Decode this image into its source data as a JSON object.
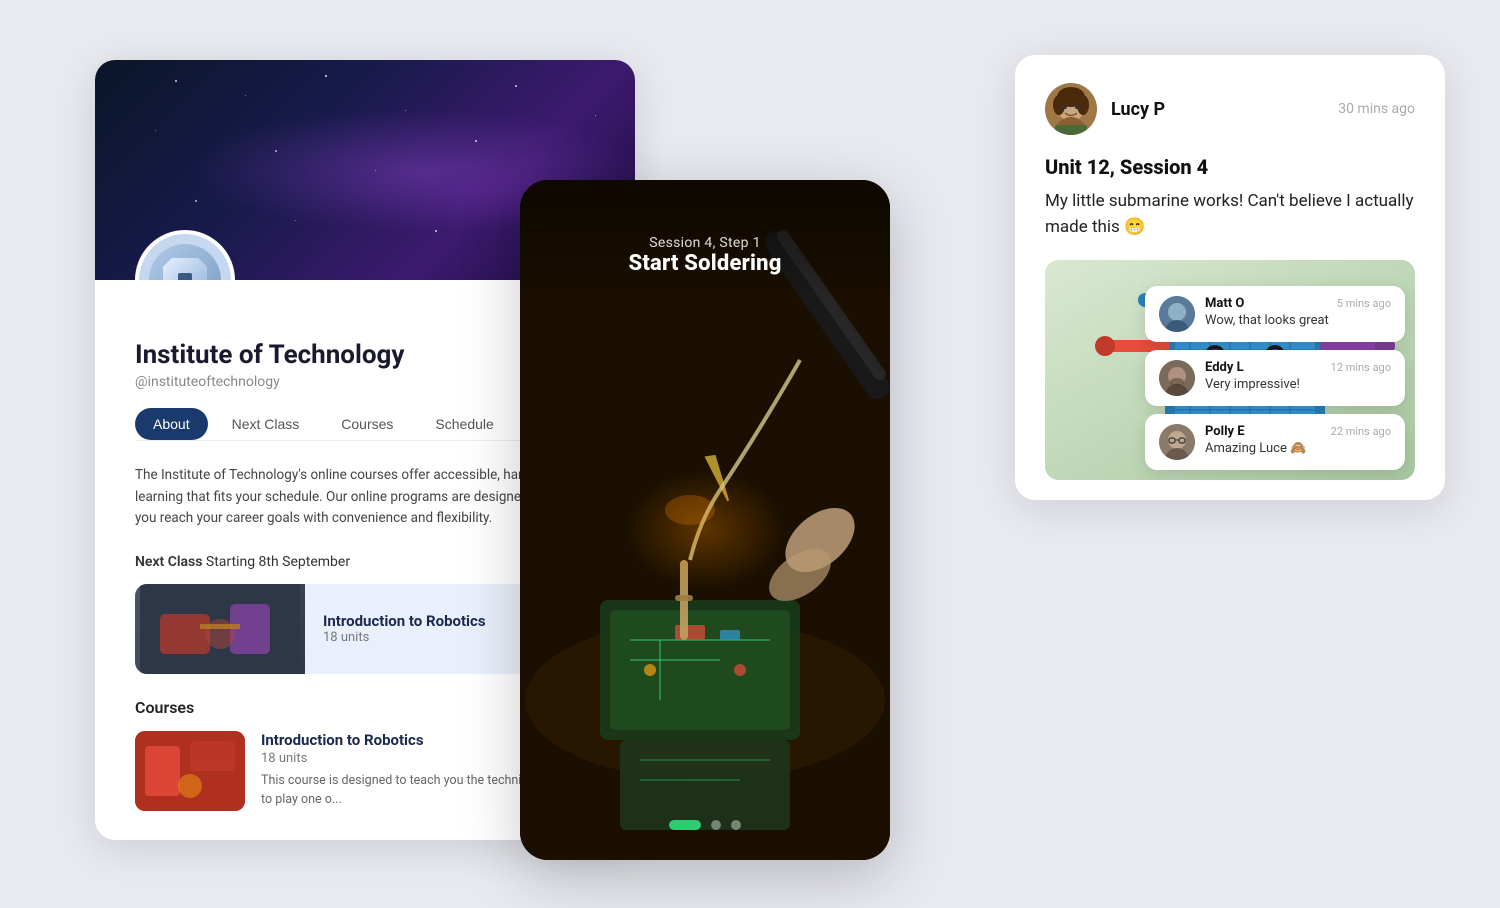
{
  "institute": {
    "name": "Institute of Technology",
    "handle": "@instituteoftechnology",
    "description": "The Institute of Technology's online courses offer accessible, hands-on learning that fits your schedule. Our online programs are designed to help you reach your career goals with convenience and flexibility.",
    "tabs": [
      "About",
      "Next Class",
      "Courses",
      "Schedule"
    ],
    "active_tab": "About",
    "next_class": {
      "label": "Next Class",
      "date": "Starting 8th September",
      "course": {
        "title": "Introduction to Robotics",
        "units": "18 units"
      }
    },
    "courses_section": "Courses",
    "course_list": [
      {
        "title": "Introduction to Robotics",
        "units": "18 units",
        "desc": "This course is designed to teach you the techniques needed to play one o..."
      }
    ]
  },
  "session": {
    "step_label": "Session 4, Step 1",
    "title": "Start Soldering",
    "dots": [
      {
        "active": true
      },
      {
        "active": false
      },
      {
        "active": false
      }
    ]
  },
  "post": {
    "username": "Lucy P",
    "time": "30 mins ago",
    "unit": "Unit 12, Session 4",
    "text": "My little submarine works! Can't believe I actually made this 😁",
    "comments": [
      {
        "name": "Matt O",
        "time": "5 mins ago",
        "text": "Wow, that looks great",
        "avatar_emoji": "👦"
      },
      {
        "name": "Eddy L",
        "time": "12 mins ago",
        "text": "Very impressive!",
        "avatar_emoji": "👨"
      },
      {
        "name": "Polly E",
        "time": "22 mins ago",
        "text": "Amazing Luce 🙈",
        "avatar_emoji": "👩"
      }
    ]
  }
}
